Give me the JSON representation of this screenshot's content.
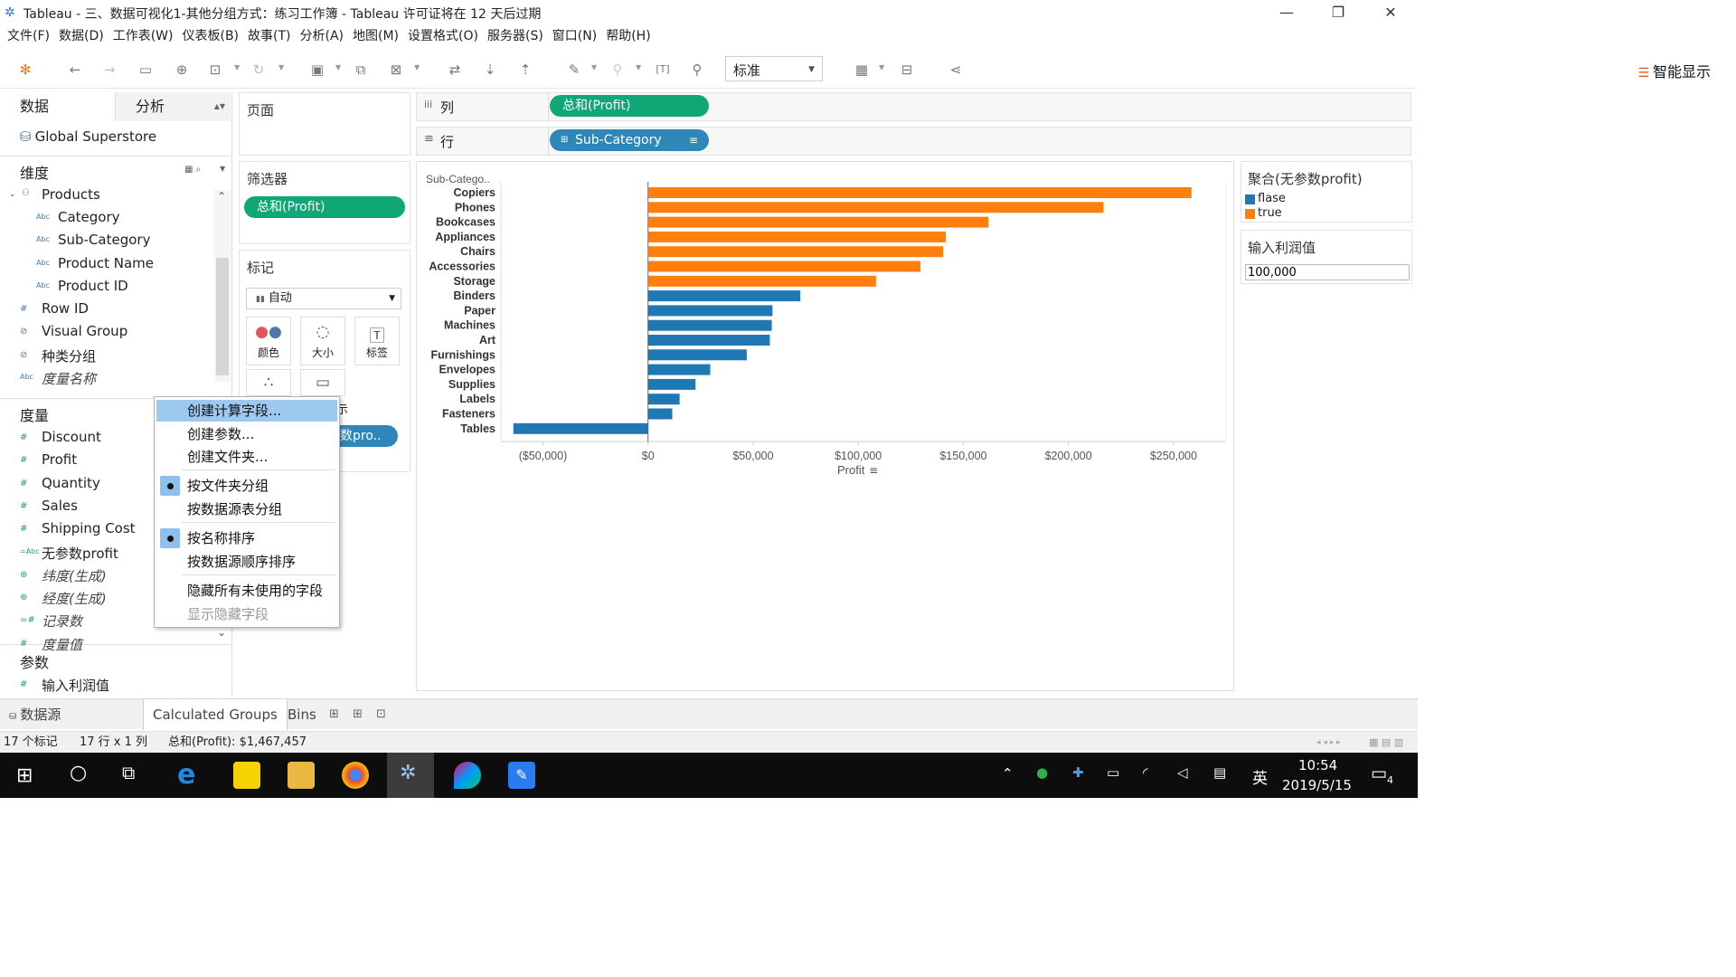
{
  "window": {
    "title": "Tableau - 三、数据可视化1-其他分组方式：练习工作簿 - Tableau 许可证将在 12 天后过期"
  },
  "menu": [
    "文件(F)",
    "数据(D)",
    "工作表(W)",
    "仪表板(B)",
    "故事(T)",
    "分析(A)",
    "地图(M)",
    "设置格式(O)",
    "服务器(S)",
    "窗口(N)",
    "帮助(H)"
  ],
  "toolbar": {
    "view_select": "标准",
    "smart_show": "智能显示"
  },
  "data_pane": {
    "tab_data": "数据",
    "tab_analysis": "分析",
    "source": "Global Superstore",
    "dimensions_title": "维度",
    "products_folder": "Products",
    "product_fields": [
      "Category",
      "Sub-Category",
      "Product Name",
      "Product ID"
    ],
    "dimension_fields": [
      {
        "name": "Row ID",
        "icon": "#",
        "italic": false
      },
      {
        "name": "Visual Group",
        "icon": "paperclip",
        "italic": false
      },
      {
        "name": "种类分组",
        "icon": "paperclip",
        "italic": false
      },
      {
        "name": "度量名称",
        "icon": "Abc",
        "italic": true
      }
    ],
    "measures_title": "度量",
    "measure_fields": [
      {
        "name": "Discount",
        "icon": "#",
        "italic": false
      },
      {
        "name": "Profit",
        "icon": "#",
        "italic": false
      },
      {
        "name": "Quantity",
        "icon": "#",
        "italic": false
      },
      {
        "name": "Sales",
        "icon": "#",
        "italic": false
      },
      {
        "name": "Shipping Cost",
        "icon": "#",
        "italic": false
      },
      {
        "name": "无参数profit",
        "icon": "=Abc",
        "italic": false
      },
      {
        "name": "纬度(生成)",
        "icon": "globe",
        "italic": true
      },
      {
        "name": "经度(生成)",
        "icon": "globe",
        "italic": true
      },
      {
        "name": "记录数",
        "icon": "=#",
        "italic": true
      },
      {
        "name": "度量值",
        "icon": "#",
        "italic": true
      }
    ],
    "params_title": "参数",
    "param_fields": [
      "输入利润值"
    ]
  },
  "shelves": {
    "pages_title": "页面",
    "filters_title": "筛选器",
    "filter_pill": "总和(Profit)",
    "marks_title": "标记",
    "marks_type": "自动",
    "mark_buttons": [
      "颜色",
      "大小",
      "标签"
    ],
    "mark_extra_visible": "示",
    "mark_pill_visible": "数pro..",
    "columns_label": "列",
    "rows_label": "行",
    "columns_pill": "总和(Profit)",
    "rows_pill": "Sub-Category"
  },
  "context_menu": {
    "items": [
      {
        "label": "创建计算字段...",
        "highlighted": true,
        "checked": false,
        "disabled": false
      },
      {
        "label": "创建参数...",
        "highlighted": false,
        "checked": false,
        "disabled": false
      },
      {
        "label": "创建文件夹...",
        "highlighted": false,
        "checked": false,
        "disabled": false
      },
      {
        "label": "按文件夹分组",
        "highlighted": false,
        "checked": true,
        "disabled": false
      },
      {
        "label": "按数据源表分组",
        "highlighted": false,
        "checked": false,
        "disabled": false
      },
      {
        "label": "按名称排序",
        "highlighted": false,
        "checked": true,
        "disabled": false
      },
      {
        "label": "按数据源顺序排序",
        "highlighted": false,
        "checked": false,
        "disabled": false
      },
      {
        "label": "隐藏所有未使用的字段",
        "highlighted": false,
        "checked": false,
        "disabled": false
      },
      {
        "label": "显示隐藏字段",
        "highlighted": false,
        "checked": false,
        "disabled": true
      }
    ]
  },
  "legend": {
    "title": "聚合(无参数profit)",
    "items": [
      {
        "label": "flase",
        "color": "#1f77b4"
      },
      {
        "label": "true",
        "color": "#ff7f0e"
      }
    ]
  },
  "parameter_card": {
    "title": "输入利润值",
    "value": "100,000"
  },
  "chart_data": {
    "type": "bar",
    "orientation": "horizontal",
    "row_header": "Sub-Catego..",
    "xlabel": "Profit",
    "xlim": [
      -70000,
      275000
    ],
    "x_ticks": [
      -50000,
      0,
      50000,
      100000,
      150000,
      200000,
      250000
    ],
    "x_tick_labels": [
      "($50,000)",
      "$0",
      "$50,000",
      "$100,000",
      "$150,000",
      "$200,000",
      "$250,000"
    ],
    "categories": [
      "Copiers",
      "Phones",
      "Bookcases",
      "Appliances",
      "Chairs",
      "Accessories",
      "Storage",
      "Binders",
      "Paper",
      "Machines",
      "Art",
      "Furnishings",
      "Envelopes",
      "Supplies",
      "Labels",
      "Fasteners",
      "Tables"
    ],
    "values": [
      258567,
      216717,
      161924,
      141681,
      140396,
      129626,
      108461,
      72449,
      59208,
      58867,
      57954,
      46967,
      29601,
      22583,
      15010,
      11526,
      -64083
    ],
    "groups": [
      "true",
      "true",
      "true",
      "true",
      "true",
      "true",
      "true",
      "flase",
      "flase",
      "flase",
      "flase",
      "flase",
      "flase",
      "flase",
      "flase",
      "flase",
      "flase"
    ],
    "group_colors": {
      "true": "#ff7f0e",
      "flase": "#1f77b4"
    },
    "grid": false
  },
  "sheet_tabs": {
    "datasource": "数据源",
    "tabs": [
      "Calculated Groups",
      "Bins"
    ]
  },
  "status": {
    "marks": "17 个标记",
    "dims": "17 行 x 1 列",
    "sum": "总和(Profit): $1,467,457"
  },
  "taskbar": {
    "ime": "英",
    "time": "10:54",
    "date": "2019/5/15",
    "notifications": "4"
  }
}
